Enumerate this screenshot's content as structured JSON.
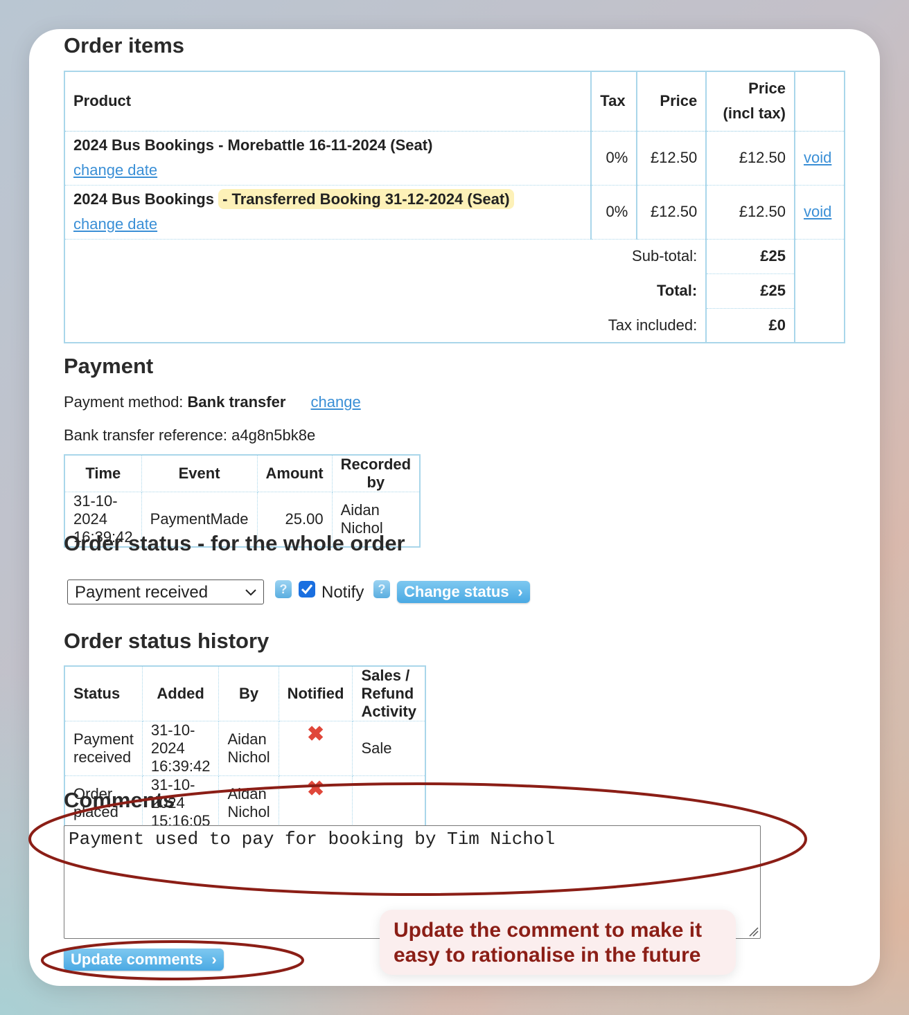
{
  "order_items": {
    "heading": "Order items",
    "headers": {
      "product": "Product",
      "tax": "Tax",
      "price": "Price",
      "price_incl_1": "Price",
      "price_incl_2": "(incl tax)"
    },
    "rows": [
      {
        "product": "2024 Bus Bookings - Morebattle 16-11-2024 (Seat)",
        "change_link": "change date",
        "tax": "0%",
        "price": "£12.50",
        "price_incl": "£12.50",
        "void": "void"
      },
      {
        "product_prefix": "2024 Bus Bookings ",
        "product_highlight": "- Transferred Booking 31-12-2024 (Seat)",
        "change_link": "change date",
        "tax": "0%",
        "price": "£12.50",
        "price_incl": "£12.50",
        "void": "void"
      }
    ],
    "subtotal_label": "Sub-total:",
    "subtotal": "£25",
    "total_label": "Total:",
    "total": "£25",
    "tax_label": "Tax included:",
    "tax_included": "£0"
  },
  "payment": {
    "heading": "Payment",
    "method_label": "Payment method: ",
    "method": "Bank transfer",
    "change_link": "change",
    "reference": "Bank transfer reference: a4g8n5bk8e",
    "headers": [
      "Time",
      "Event",
      "Amount",
      "Recorded by"
    ],
    "rows": [
      {
        "time": "31-10-2024 16:39:42",
        "event": "PaymentMade",
        "amount": "25.00",
        "by": "Aidan Nichol"
      }
    ]
  },
  "order_status": {
    "heading": "Order status - for the whole order",
    "select_value": "Payment received",
    "help_glyph": "?",
    "notify_label": "Notify",
    "notify_checked": true,
    "change_button": "Change status",
    "chevron": "›"
  },
  "history": {
    "heading": "Order status history",
    "headers": [
      "Status",
      "Added",
      "By",
      "Notified",
      "Sales / Refund Activity"
    ],
    "rows": [
      {
        "status": "Payment received",
        "added": "31-10-2024 16:39:42",
        "by": "Aidan Nichol",
        "notified": "✖",
        "activity": "Sale"
      },
      {
        "status": "Order placed",
        "added": "31-10-2024 15:16:05",
        "by": "Aidan Nichol",
        "notified": "✖",
        "activity": ""
      }
    ]
  },
  "comments": {
    "heading": "Comments",
    "text": "Payment used to pay for booking by Tim Nichol",
    "update_button": "Update comments"
  },
  "annotation": {
    "callout": "Update the comment to make it easy to rationalise in the future",
    "color": "#8b1e16"
  }
}
